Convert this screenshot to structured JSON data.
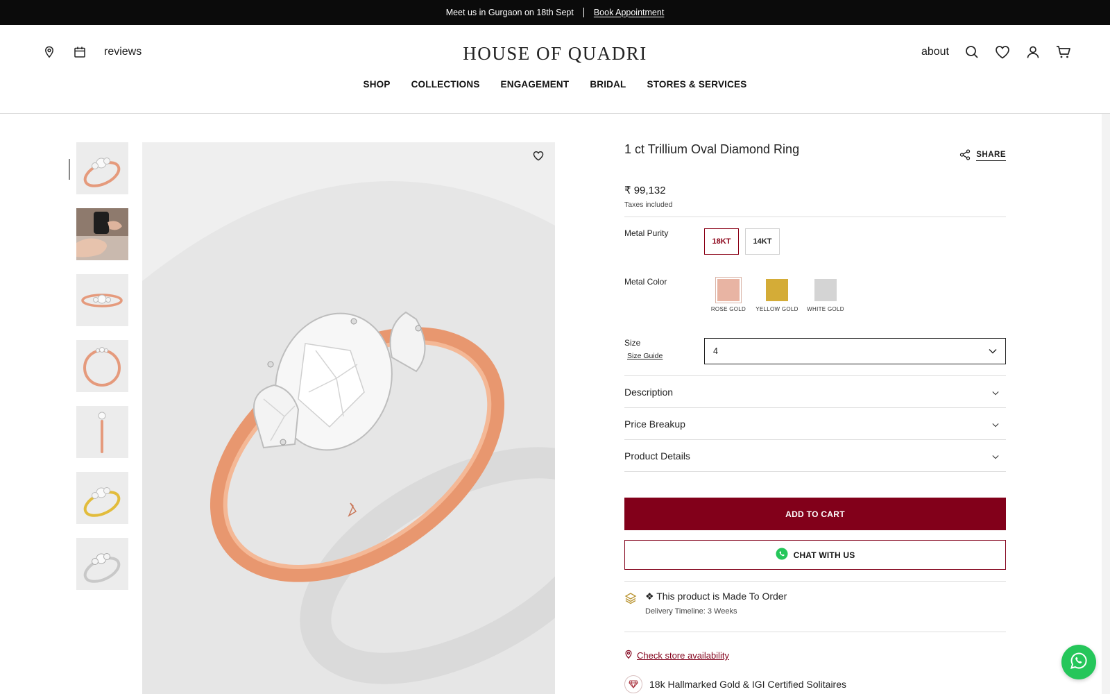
{
  "announcement": {
    "text": "Meet us in Gurgaon on 18th Sept",
    "link": "Book Appointment"
  },
  "header": {
    "reviews_label": "reviews",
    "logo": "HOUSE OF QUADRI",
    "about_label": "about",
    "icons_left": [
      "location-icon",
      "calendar-icon"
    ],
    "icons_right": [
      "search-icon",
      "heart-icon",
      "user-icon",
      "cart-icon"
    ]
  },
  "nav": [
    "SHOP",
    "COLLECTIONS",
    "ENGAGEMENT",
    "BRIDAL",
    "STORES & SERVICES"
  ],
  "gallery": {
    "thumbnails": [
      "rose-gold-ring-front",
      "hand-with-ring",
      "rose-gold-ring-side",
      "rose-gold-ring-top",
      "rose-gold-ring-profile",
      "yellow-gold-ring-front",
      "white-gold-ring-front"
    ]
  },
  "product": {
    "title": "1 ct Trillium Oval Diamond Ring",
    "share_label": "SHARE",
    "price": "₹ 99,132",
    "taxes_note": "Taxes included",
    "metal_purity_label": "Metal Purity",
    "purity_options": [
      "18KT",
      "14KT"
    ],
    "purity_selected": "18KT",
    "metal_color_label": "Metal Color",
    "color_options": [
      {
        "label": "ROSE GOLD",
        "color": "#e8b4a3"
      },
      {
        "label": "YELLOW GOLD",
        "color": "#d4ac37"
      },
      {
        "label": "WHITE GOLD",
        "color": "#d4d4d4"
      }
    ],
    "color_selected": "ROSE GOLD",
    "size_label": "Size",
    "size_guide": "Size Guide",
    "size_value": "4",
    "accordions": [
      "Description",
      "Price Breakup",
      "Product Details"
    ],
    "add_to_cart": "ADD TO CART",
    "chat_label": "CHAT WITH US",
    "made_to_order": "❖ This product is Made To Order",
    "delivery": "Delivery Timeline: 3 Weeks",
    "store_availability": "Check store availability",
    "certification": "18k Hallmarked Gold & IGI Certified Solitaires"
  },
  "colors": {
    "brand": "#82001a",
    "whatsapp": "#25c65a",
    "rose_gold": "#e8b4a3",
    "announcement_bg": "#0b0b0b"
  }
}
